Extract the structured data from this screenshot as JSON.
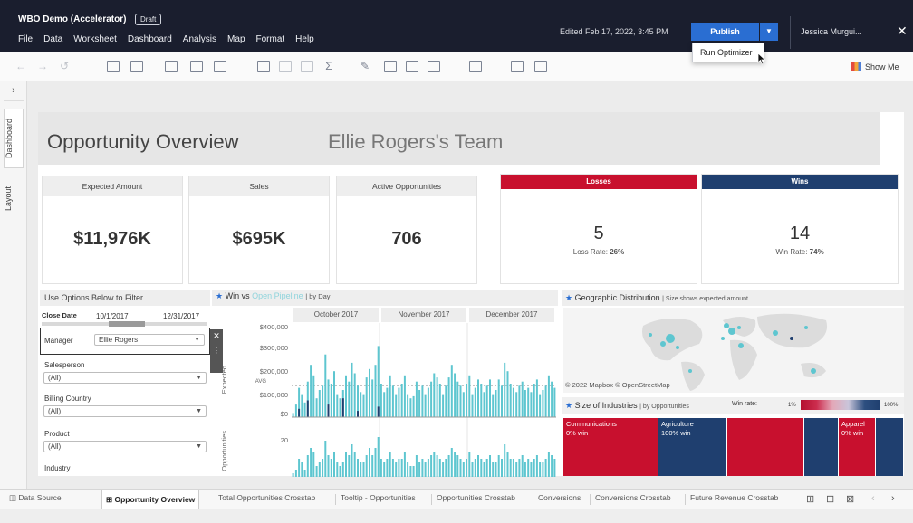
{
  "app": {
    "title": "WBO Demo (Accelerator)",
    "status_badge": "Draft",
    "menu": [
      "File",
      "Data",
      "Worksheet",
      "Dashboard",
      "Analysis",
      "Map",
      "Format",
      "Help"
    ],
    "edited": "Edited Feb 17, 2022, 3:45 PM",
    "publish_label": "Publish",
    "publish_menu_item": "Run Optimizer",
    "user_name": "Jessica Murgui...",
    "show_me_label": "Show Me"
  },
  "rail": {
    "tabs": [
      "Dashboard",
      "Layout"
    ]
  },
  "dashboard": {
    "title": "Opportunity Overview",
    "team": "Ellie Rogers's Team",
    "kpis": [
      {
        "label": "Expected Amount",
        "value": "$11,976K"
      },
      {
        "label": "Sales",
        "value": "$695K"
      },
      {
        "label": "Active Opportunities",
        "value": "706"
      }
    ],
    "losses": {
      "label": "Losses",
      "value": "5",
      "rate_label": "Loss Rate:",
      "rate": "26%",
      "color": "#c8102e"
    },
    "wins": {
      "label": "Wins",
      "value": "14",
      "rate_label": "Win Rate:",
      "rate": "74%",
      "color": "#1f3f6f"
    },
    "filters": {
      "header": "Use Options Below to Filter",
      "close_date_label": "Close Date",
      "close_date_start": "10/1/2017",
      "close_date_end": "12/31/2017",
      "manager_label": "Manager",
      "manager_value": "Ellie Rogers",
      "salesperson_label": "Salesperson",
      "salesperson_value": "(All)",
      "billing_country_label": "Billing Country",
      "billing_country_value": "(All)",
      "product_label": "Product",
      "product_value": "(All)",
      "industry_label": "Industry"
    },
    "win_chart": {
      "title_win": "Win",
      "title_vs": "vs",
      "title_pipeline": "Open Pipeline",
      "title_suffix": "| by Day",
      "months": [
        "October 2017",
        "November 2017",
        "December 2017"
      ],
      "y_ticks": [
        "$400,000",
        "$300,000",
        "$200,000",
        "$100,000",
        "$0"
      ],
      "y_label": "Expected",
      "y2_label": "Opportunities",
      "y2_tick": "20",
      "avg_label": "AVG"
    },
    "geo": {
      "title": "Geographic Distribution",
      "subtitle": "| Size shows expected amount",
      "credit": "© 2022 Mapbox  © OpenStreetMap"
    },
    "industries": {
      "title": "Size of Industries",
      "subtitle": "| by Opportunities",
      "win_rate_label": "Win rate:",
      "legend_min": "1%",
      "legend_max": "100%",
      "cells": [
        {
          "name": "Communications",
          "pct": "0% win",
          "color": "#c8102e"
        },
        {
          "name": "Agriculture",
          "pct": "100% win",
          "color": "#1f3f6f"
        },
        {
          "name": "",
          "pct": "",
          "color": "#c8102e"
        },
        {
          "name": "",
          "pct": "",
          "color": "#1f3f6f"
        },
        {
          "name": "Apparel",
          "pct": "0% win",
          "color": "#c8102e"
        }
      ]
    },
    "colors": {
      "win": "#1f3f6f",
      "pipeline": "#5ec6d0",
      "loss": "#c8102e",
      "accent": "#2a6ed2"
    }
  },
  "chart_data": {
    "type": "bar",
    "title": "Win vs Open Pipeline | by Day",
    "ylabel": "Expected",
    "ylim": [
      0,
      450000
    ],
    "categories": [
      "October 2017",
      "November 2017",
      "December 2017"
    ],
    "series": [
      {
        "name": "Win",
        "values_by_day": [
          0,
          0,
          40000,
          0,
          0,
          80000,
          0,
          0,
          0,
          0,
          0,
          0,
          60000,
          0,
          0,
          0,
          0,
          90000,
          0,
          0,
          0,
          0,
          30000,
          0,
          0,
          0,
          0,
          0,
          0,
          50000,
          0,
          0,
          0,
          0,
          0,
          0,
          0,
          0,
          0,
          0,
          0,
          0,
          0,
          0,
          0,
          0,
          0,
          0,
          0,
          0,
          0,
          0,
          0,
          0,
          0,
          0,
          0,
          0,
          0,
          0,
          0,
          0,
          0,
          0,
          0,
          0,
          0,
          0,
          0,
          0,
          0,
          0,
          0,
          0,
          0,
          0,
          0,
          0,
          0,
          0,
          0,
          0,
          0,
          0,
          0,
          0,
          0,
          0,
          0,
          0
        ]
      },
      {
        "name": "Open Pipeline",
        "values_by_day": [
          20000,
          60000,
          140000,
          110000,
          70000,
          170000,
          250000,
          200000,
          90000,
          130000,
          150000,
          300000,
          180000,
          160000,
          220000,
          110000,
          90000,
          130000,
          200000,
          170000,
          260000,
          210000,
          150000,
          120000,
          110000,
          190000,
          230000,
          180000,
          250000,
          340000,
          160000,
          120000,
          140000,
          200000,
          150000,
          110000,
          140000,
          160000,
          200000,
          110000,
          90000,
          100000,
          170000,
          130000,
          150000,
          110000,
          140000,
          170000,
          210000,
          190000,
          160000,
          110000,
          150000,
          190000,
          250000,
          210000,
          170000,
          150000,
          120000,
          160000,
          200000,
          110000,
          140000,
          180000,
          160000,
          120000,
          150000,
          180000,
          110000,
          130000,
          180000,
          150000,
          260000,
          220000,
          160000,
          140000,
          120000,
          150000,
          170000,
          130000,
          140000,
          120000,
          160000,
          180000,
          110000,
          130000,
          150000,
          200000,
          170000,
          140000
        ]
      }
    ]
  },
  "tabs": {
    "data_source": "Data Source",
    "sheets": [
      "Opportunity Overview",
      "Total Opportunities Crosstab",
      "Tooltip - Opportunities",
      "Opportunities Crosstab",
      "Conversions",
      "Conversions Crosstab",
      "Future Revenue Crosstab"
    ]
  }
}
